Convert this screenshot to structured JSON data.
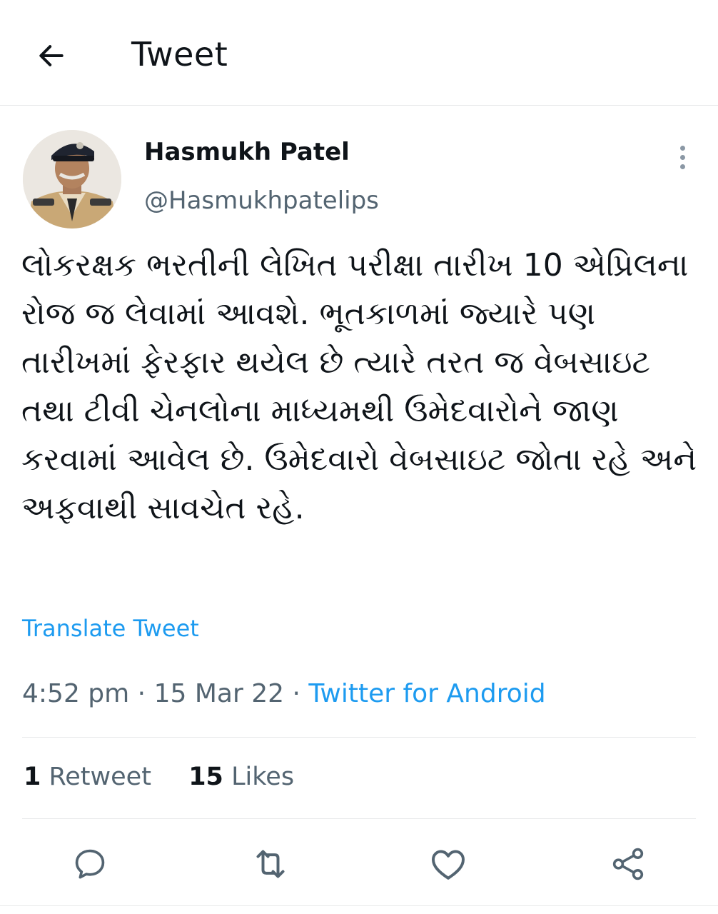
{
  "header": {
    "title": "Tweet",
    "back_icon": "arrow-left-icon"
  },
  "author": {
    "display_name": "Hasmukh Patel",
    "handle": "@Hasmukhpatelips",
    "avatar": "avatar-photo",
    "more_icon": "more-vertical-icon"
  },
  "tweet": {
    "text": "લોકરક્ષક ભરતીની લેખિત પરીક્ષા તારીખ 10 એપ્રિલના રોજ જ લેવામાં આવશે. ભૂતકાળમાં જ્યારે પણ તારીખમાં ફેરફાર થયેલ છે ત્યારે તરત જ વેબસાઇટ તથા ટીવી ચેનલોના માધ્યમથી ઉમેદવારોને જાણ કરવામાં આવેલ છે. ઉમેદવારો વેબસાઇટ જોતા રહે અને અફવાથી સાવચેત રહે.",
    "translate_label": "Translate Tweet",
    "time": "4:52 pm",
    "separator": "·",
    "date": "15 Mar 22",
    "source": "Twitter for Android"
  },
  "stats": {
    "retweet_count": "1",
    "retweet_label": "Retweet",
    "like_count": "15",
    "like_label": "Likes"
  },
  "actions": {
    "reply_icon": "reply-icon",
    "retweet_icon": "retweet-icon",
    "like_icon": "heart-icon",
    "share_icon": "share-icon"
  },
  "colors": {
    "accent": "#1d9bf0",
    "text_primary": "#0f1419",
    "text_secondary": "#536471",
    "divider": "#e7e9ea",
    "icon": "#536471"
  }
}
